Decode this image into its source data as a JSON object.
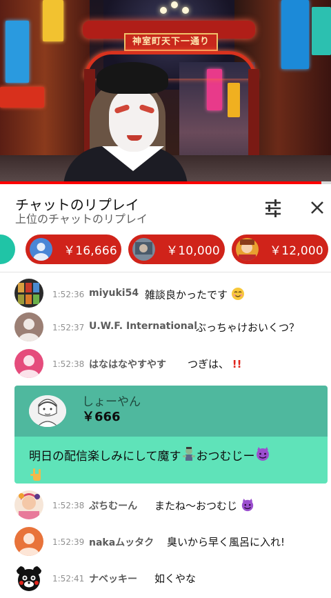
{
  "video": {
    "arch_sign": "神室町天下一通り",
    "progress_percent": 97
  },
  "header": {
    "title": "チャットのリプレイ",
    "subtitle": "上位のチャットのリプレイ",
    "filter_icon": "tune-icon",
    "close_icon": "close-icon"
  },
  "ticker": {
    "chips": [
      {
        "amount": "￥16,666",
        "color": "#d0231a"
      },
      {
        "amount": "￥10,000",
        "color": "#d0231a"
      },
      {
        "amount": "￥12,000",
        "color": "#d0231a"
      }
    ]
  },
  "messages": [
    {
      "time": "1:52:36",
      "author": "miyuki54",
      "text": "雑談良かったです"
    },
    {
      "time": "1:52:37",
      "author": "U.W.F. International",
      "text": "ぶっちゃけおいくつ？"
    },
    {
      "time": "1:52:38",
      "author": "はなはなやすやす",
      "text": "つぎは、"
    },
    {
      "time": "1:52:38",
      "author": "ぷちむーん",
      "text": "またね〜おつむじ"
    },
    {
      "time": "1:52:39",
      "author": "nakaムッタク",
      "text": "臭いから早く風呂に入れ!"
    },
    {
      "time": "1:52:41",
      "author": "ナベッキー",
      "text": "如くやな"
    }
  ],
  "superchat": {
    "name": "しょーやん",
    "amount": "￥666",
    "text": "明日の配信楽しみにして魔す",
    "text_tail": "おつむじー"
  }
}
